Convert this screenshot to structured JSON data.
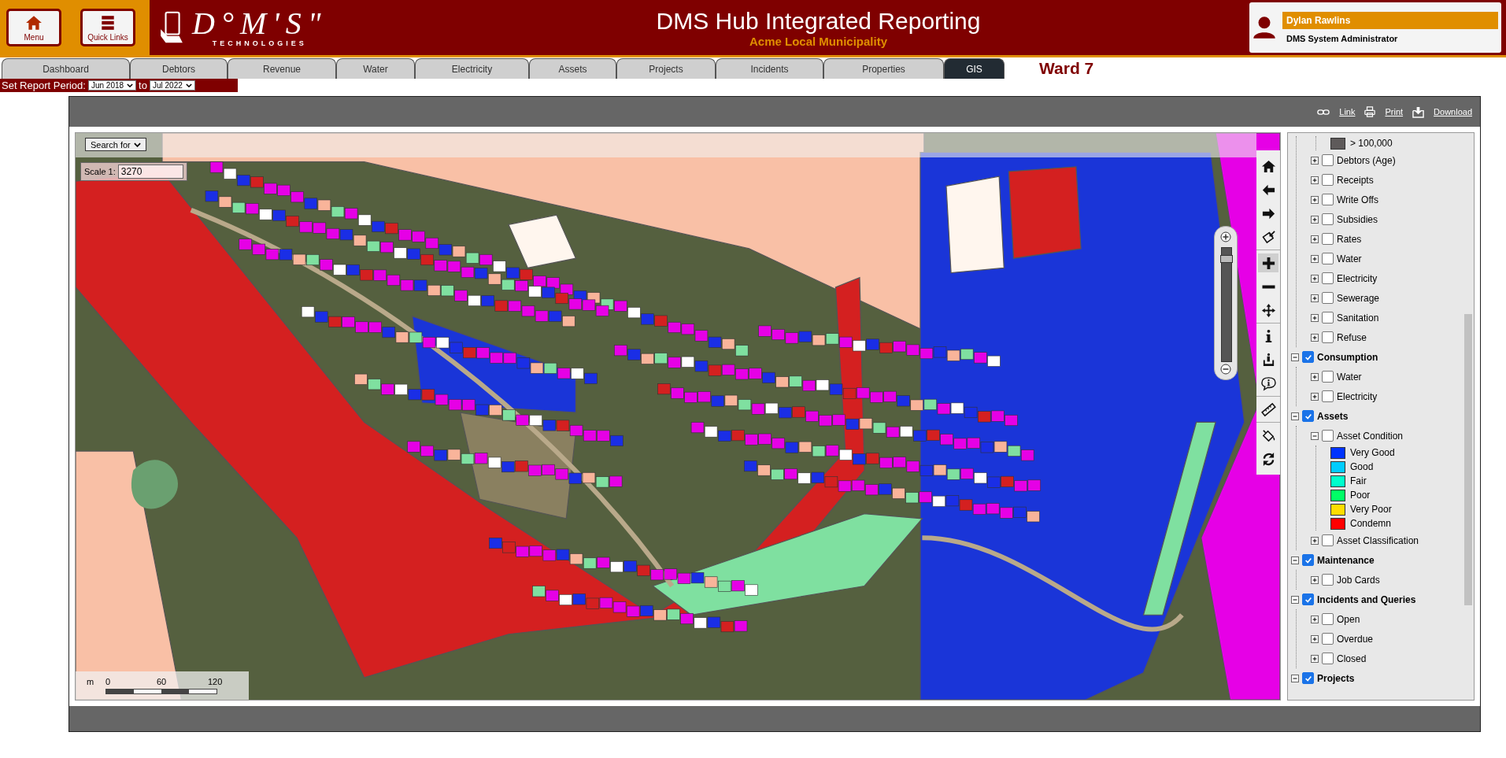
{
  "header": {
    "buttons": [
      {
        "kind": "home",
        "label": "Menu"
      },
      {
        "kind": "links",
        "label": "Quick Links"
      }
    ],
    "logo": {
      "text": "D°M'S\"",
      "subtitle": "TECHNOLOGIES"
    },
    "title": "DMS Hub Integrated Reporting",
    "subtitle": "Acme Local Municipality",
    "user": {
      "name": "Dylan Rawlins",
      "role": "DMS System Administrator"
    }
  },
  "tabs": [
    {
      "label": "Dashboard",
      "selected": false
    },
    {
      "label": "Debtors",
      "selected": false
    },
    {
      "label": "Revenue",
      "selected": false
    },
    {
      "label": "Water",
      "selected": false
    },
    {
      "label": "Electricity",
      "selected": false
    },
    {
      "label": "Assets",
      "selected": false
    },
    {
      "label": "Projects",
      "selected": false
    },
    {
      "label": "Incidents",
      "selected": false
    },
    {
      "label": "Properties",
      "selected": false
    },
    {
      "label": "GIS",
      "selected": true
    }
  ],
  "ward": "Ward 7",
  "report_period": {
    "label": "Set Report Period:",
    "from": "Jun 2018",
    "joiner": "to",
    "to": "Jul 2022"
  },
  "panel_links": [
    {
      "kind": "link",
      "label": "Link"
    },
    {
      "kind": "print",
      "label": "Print"
    },
    {
      "kind": "download",
      "label": "Download"
    }
  ],
  "map": {
    "search": {
      "value": "Search for"
    },
    "scale": {
      "label": "Scale 1:",
      "value": "3270"
    },
    "scale_bar": {
      "unit": "m",
      "ticks": [
        "0",
        "60",
        "120"
      ]
    },
    "zoom_slider": {
      "level": 0.93
    },
    "tool_groups": [
      {
        "tools": [
          {
            "kind": "home",
            "selected": false
          },
          {
            "kind": "back",
            "selected": false
          },
          {
            "kind": "forward",
            "selected": false
          },
          {
            "kind": "extent",
            "selected": false
          }
        ]
      },
      {
        "tools": [
          {
            "kind": "zoom_in",
            "selected": true
          },
          {
            "kind": "zoom_out",
            "selected": false
          },
          {
            "kind": "pan",
            "selected": false
          }
        ]
      },
      {
        "tools": [
          {
            "kind": "info",
            "selected": false
          },
          {
            "kind": "info_pin",
            "selected": false
          },
          {
            "kind": "info_bubble",
            "selected": false
          }
        ]
      },
      {
        "tools": [
          {
            "kind": "measure",
            "selected": false
          }
        ]
      },
      {
        "tools": [
          {
            "kind": "fill",
            "selected": false
          },
          {
            "kind": "refresh",
            "selected": false
          }
        ]
      }
    ]
  },
  "legend": {
    "layers": [
      {
        "kind": "continued",
        "children": [
          {
            "kind": "continued",
            "children": [
              {
                "kind": "swatch",
                "label": "> 100,000",
                "color": "#5e5a5a"
              }
            ]
          },
          {
            "kind": "layer",
            "label": "Debtors (Age)",
            "checked": false,
            "expanded": false
          },
          {
            "kind": "layer",
            "label": "Receipts",
            "checked": false,
            "expanded": false
          },
          {
            "kind": "layer",
            "label": "Write Offs",
            "checked": false,
            "expanded": false
          },
          {
            "kind": "layer",
            "label": "Subsidies",
            "checked": false,
            "expanded": false
          },
          {
            "kind": "layer",
            "label": "Rates",
            "checked": false,
            "expanded": false
          },
          {
            "kind": "layer",
            "label": "Water",
            "checked": false,
            "expanded": false
          },
          {
            "kind": "layer",
            "label": "Electricity",
            "checked": false,
            "expanded": false
          },
          {
            "kind": "layer",
            "label": "Sewerage",
            "checked": false,
            "expanded": false
          },
          {
            "kind": "layer",
            "label": "Sanitation",
            "checked": false,
            "expanded": false
          },
          {
            "kind": "layer",
            "label": "Refuse",
            "checked": false,
            "expanded": false
          }
        ]
      },
      {
        "kind": "group",
        "label": "Consumption",
        "checked": true,
        "expanded": true,
        "children": [
          {
            "kind": "layer",
            "label": "Water",
            "checked": false,
            "expanded": false
          },
          {
            "kind": "layer",
            "label": "Electricity",
            "checked": false,
            "expanded": false
          }
        ]
      },
      {
        "kind": "group",
        "label": "Assets",
        "checked": true,
        "expanded": true,
        "children": [
          {
            "kind": "layer",
            "label": "Asset Condition",
            "checked": false,
            "expanded": true,
            "children": [
              {
                "kind": "swatch",
                "label": "Very Good",
                "color": "#0033ff"
              },
              {
                "kind": "swatch",
                "label": "Good",
                "color": "#00ccff"
              },
              {
                "kind": "swatch",
                "label": "Fair",
                "color": "#00ffcc"
              },
              {
                "kind": "swatch",
                "label": "Poor",
                "color": "#00ff66"
              },
              {
                "kind": "swatch",
                "label": "Very Poor",
                "color": "#ffdd00"
              },
              {
                "kind": "swatch",
                "label": "Condemn",
                "color": "#ff0000"
              }
            ]
          },
          {
            "kind": "layer",
            "label": "Asset Classification",
            "checked": false,
            "expanded": false
          }
        ]
      },
      {
        "kind": "group",
        "label": "Maintenance",
        "checked": true,
        "expanded": true,
        "children": [
          {
            "kind": "layer",
            "label": "Job Cards",
            "checked": false,
            "expanded": false
          }
        ]
      },
      {
        "kind": "group",
        "label": "Incidents and Queries",
        "checked": true,
        "expanded": true,
        "children": [
          {
            "kind": "layer",
            "label": "Open",
            "checked": false,
            "expanded": false
          },
          {
            "kind": "layer",
            "label": "Overdue",
            "checked": false,
            "expanded": false
          },
          {
            "kind": "layer",
            "label": "Closed",
            "checked": false,
            "expanded": false
          }
        ]
      },
      {
        "kind": "group",
        "label": "Projects",
        "checked": true,
        "expanded": true
      }
    ]
  }
}
